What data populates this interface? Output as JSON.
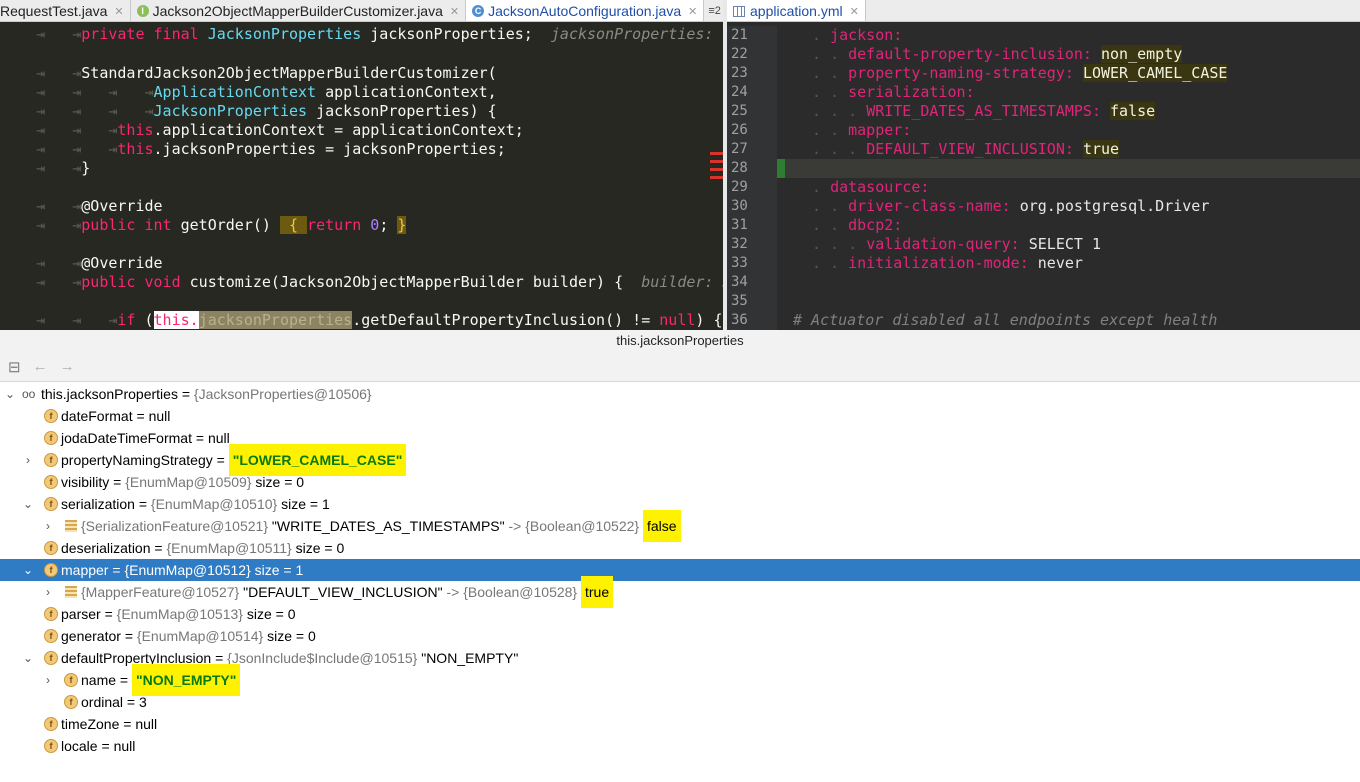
{
  "left_tabs": [
    {
      "label": "RequestTest.java",
      "icon": "none"
    },
    {
      "label": "Jackson2ObjectMapperBuilderCustomizer.java",
      "icon": "java-interface-icon"
    },
    {
      "label": "JacksonAutoConfiguration.java",
      "icon": "java-class-icon",
      "active": true
    }
  ],
  "tab_overflow": "≡2",
  "right_tab": {
    "label": "application.yml"
  },
  "java_code": [
    "private final JacksonProperties jacksonProperties;",
    "StandardJackson2ObjectMapperBuilderCustomizer(",
    "ApplicationContext applicationContext,",
    "JacksonProperties jacksonProperties) {",
    "this.applicationContext = applicationContext;",
    "this.jacksonProperties = jacksonProperties;",
    "}",
    "@Override",
    "public int getOrder() { return 0; }",
    "@Override",
    "public void customize(Jackson2ObjectMapperBuilder builder) {",
    "if (this.jacksonProperties.getDefaultPropertyInclusion() != null) {"
  ],
  "java_hints": {
    "line1": "jacksonProperties: J",
    "line11": "builder: Ja"
  },
  "yml_line_numbers": [
    "21",
    "22",
    "23",
    "24",
    "25",
    "26",
    "27",
    "28",
    "29",
    "30",
    "31",
    "32",
    "33",
    "34",
    "35",
    "36"
  ],
  "yml": {
    "jackson": "jackson:",
    "dpi_key": "default-property-inclusion:",
    "dpi_val": "non_empty",
    "pns_key": "property-naming-strategy:",
    "pns_val": "LOWER_CAMEL_CASE",
    "ser_key": "serialization:",
    "wdt_key": "WRITE_DATES_AS_TIMESTAMPS:",
    "wdt_val": "false",
    "mapper_key": "mapper:",
    "dvi_key": "DEFAULT_VIEW_INCLUSION:",
    "dvi_val": "true",
    "ds_key": "datasource:",
    "dcn_key": "driver-class-name:",
    "dcn_val": "org.postgresql.Driver",
    "dbcp_key": "dbcp2:",
    "vq_key": "validation-query:",
    "vq_val": "SELECT 1",
    "im_key": "initialization-mode:",
    "im_val": "never",
    "comment": "# Actuator disabled all endpoints except health"
  },
  "debugger": {
    "title": "this.jacksonProperties",
    "rows": {
      "root_name": "this.jacksonProperties",
      "root_ref": "{JacksonProperties@10506}",
      "dateFormat": "dateFormat",
      "dateFormat_val": "null",
      "joda": "jodaDateTimeFormat",
      "joda_val": "null",
      "pns": "propertyNamingStrategy",
      "pns_val": "\"LOWER_CAMEL_CASE\"",
      "vis": "visibility",
      "vis_ref": "{EnumMap@10509}",
      "vis_size": "size = 0",
      "ser": "serialization",
      "ser_ref": "{EnumMap@10510}",
      "ser_size": "size = 1",
      "ser_entry_key_ref": "{SerializationFeature@10521}",
      "ser_entry_key": "\"WRITE_DATES_AS_TIMESTAMPS\"",
      "ser_entry_arrow": "->",
      "ser_entry_val_ref": "{Boolean@10522}",
      "ser_entry_val": "false",
      "deser": "deserialization",
      "deser_ref": "{EnumMap@10511}",
      "deser_size": "size = 0",
      "mapper": "mapper",
      "mapper_ref": "{EnumMap@10512}",
      "mapper_size": "size = 1",
      "map_entry_key_ref": "{MapperFeature@10527}",
      "map_entry_key": "\"DEFAULT_VIEW_INCLUSION\"",
      "map_entry_arrow": "->",
      "map_entry_val_ref": "{Boolean@10528}",
      "map_entry_val": "true",
      "parser": "parser",
      "parser_ref": "{EnumMap@10513}",
      "parser_size": "size = 0",
      "generator": "generator",
      "generator_ref": "{EnumMap@10514}",
      "generator_size": "size = 0",
      "dpi": "defaultPropertyInclusion",
      "dpi_ref": "{JsonInclude$Include@10515}",
      "dpi_val": "\"NON_EMPTY\"",
      "name": "name",
      "name_val": "\"NON_EMPTY\"",
      "ordinal": "ordinal",
      "ordinal_val": "3",
      "tz": "timeZone",
      "tz_val": "null",
      "locale": "locale",
      "locale_val": "null"
    }
  },
  "colors": {
    "selection": "#2f7bc4",
    "highlight_yellow": "#fff200",
    "editor_bg_left": "#272822",
    "editor_bg_right": "#2b2b2b"
  }
}
